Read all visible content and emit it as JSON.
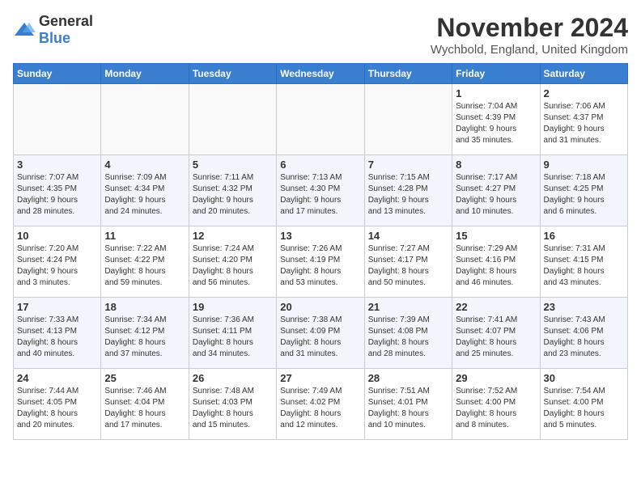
{
  "header": {
    "logo_general": "General",
    "logo_blue": "Blue",
    "month_title": "November 2024",
    "location": "Wychbold, England, United Kingdom"
  },
  "weekdays": [
    "Sunday",
    "Monday",
    "Tuesday",
    "Wednesday",
    "Thursday",
    "Friday",
    "Saturday"
  ],
  "weeks": [
    [
      {
        "day": "",
        "info": ""
      },
      {
        "day": "",
        "info": ""
      },
      {
        "day": "",
        "info": ""
      },
      {
        "day": "",
        "info": ""
      },
      {
        "day": "",
        "info": ""
      },
      {
        "day": "1",
        "info": "Sunrise: 7:04 AM\nSunset: 4:39 PM\nDaylight: 9 hours\nand 35 minutes."
      },
      {
        "day": "2",
        "info": "Sunrise: 7:06 AM\nSunset: 4:37 PM\nDaylight: 9 hours\nand 31 minutes."
      }
    ],
    [
      {
        "day": "3",
        "info": "Sunrise: 7:07 AM\nSunset: 4:35 PM\nDaylight: 9 hours\nand 28 minutes."
      },
      {
        "day": "4",
        "info": "Sunrise: 7:09 AM\nSunset: 4:34 PM\nDaylight: 9 hours\nand 24 minutes."
      },
      {
        "day": "5",
        "info": "Sunrise: 7:11 AM\nSunset: 4:32 PM\nDaylight: 9 hours\nand 20 minutes."
      },
      {
        "day": "6",
        "info": "Sunrise: 7:13 AM\nSunset: 4:30 PM\nDaylight: 9 hours\nand 17 minutes."
      },
      {
        "day": "7",
        "info": "Sunrise: 7:15 AM\nSunset: 4:28 PM\nDaylight: 9 hours\nand 13 minutes."
      },
      {
        "day": "8",
        "info": "Sunrise: 7:17 AM\nSunset: 4:27 PM\nDaylight: 9 hours\nand 10 minutes."
      },
      {
        "day": "9",
        "info": "Sunrise: 7:18 AM\nSunset: 4:25 PM\nDaylight: 9 hours\nand 6 minutes."
      }
    ],
    [
      {
        "day": "10",
        "info": "Sunrise: 7:20 AM\nSunset: 4:24 PM\nDaylight: 9 hours\nand 3 minutes."
      },
      {
        "day": "11",
        "info": "Sunrise: 7:22 AM\nSunset: 4:22 PM\nDaylight: 8 hours\nand 59 minutes."
      },
      {
        "day": "12",
        "info": "Sunrise: 7:24 AM\nSunset: 4:20 PM\nDaylight: 8 hours\nand 56 minutes."
      },
      {
        "day": "13",
        "info": "Sunrise: 7:26 AM\nSunset: 4:19 PM\nDaylight: 8 hours\nand 53 minutes."
      },
      {
        "day": "14",
        "info": "Sunrise: 7:27 AM\nSunset: 4:17 PM\nDaylight: 8 hours\nand 50 minutes."
      },
      {
        "day": "15",
        "info": "Sunrise: 7:29 AM\nSunset: 4:16 PM\nDaylight: 8 hours\nand 46 minutes."
      },
      {
        "day": "16",
        "info": "Sunrise: 7:31 AM\nSunset: 4:15 PM\nDaylight: 8 hours\nand 43 minutes."
      }
    ],
    [
      {
        "day": "17",
        "info": "Sunrise: 7:33 AM\nSunset: 4:13 PM\nDaylight: 8 hours\nand 40 minutes."
      },
      {
        "day": "18",
        "info": "Sunrise: 7:34 AM\nSunset: 4:12 PM\nDaylight: 8 hours\nand 37 minutes."
      },
      {
        "day": "19",
        "info": "Sunrise: 7:36 AM\nSunset: 4:11 PM\nDaylight: 8 hours\nand 34 minutes."
      },
      {
        "day": "20",
        "info": "Sunrise: 7:38 AM\nSunset: 4:09 PM\nDaylight: 8 hours\nand 31 minutes."
      },
      {
        "day": "21",
        "info": "Sunrise: 7:39 AM\nSunset: 4:08 PM\nDaylight: 8 hours\nand 28 minutes."
      },
      {
        "day": "22",
        "info": "Sunrise: 7:41 AM\nSunset: 4:07 PM\nDaylight: 8 hours\nand 25 minutes."
      },
      {
        "day": "23",
        "info": "Sunrise: 7:43 AM\nSunset: 4:06 PM\nDaylight: 8 hours\nand 23 minutes."
      }
    ],
    [
      {
        "day": "24",
        "info": "Sunrise: 7:44 AM\nSunset: 4:05 PM\nDaylight: 8 hours\nand 20 minutes."
      },
      {
        "day": "25",
        "info": "Sunrise: 7:46 AM\nSunset: 4:04 PM\nDaylight: 8 hours\nand 17 minutes."
      },
      {
        "day": "26",
        "info": "Sunrise: 7:48 AM\nSunset: 4:03 PM\nDaylight: 8 hours\nand 15 minutes."
      },
      {
        "day": "27",
        "info": "Sunrise: 7:49 AM\nSunset: 4:02 PM\nDaylight: 8 hours\nand 12 minutes."
      },
      {
        "day": "28",
        "info": "Sunrise: 7:51 AM\nSunset: 4:01 PM\nDaylight: 8 hours\nand 10 minutes."
      },
      {
        "day": "29",
        "info": "Sunrise: 7:52 AM\nSunset: 4:00 PM\nDaylight: 8 hours\nand 8 minutes."
      },
      {
        "day": "30",
        "info": "Sunrise: 7:54 AM\nSunset: 4:00 PM\nDaylight: 8 hours\nand 5 minutes."
      }
    ]
  ]
}
